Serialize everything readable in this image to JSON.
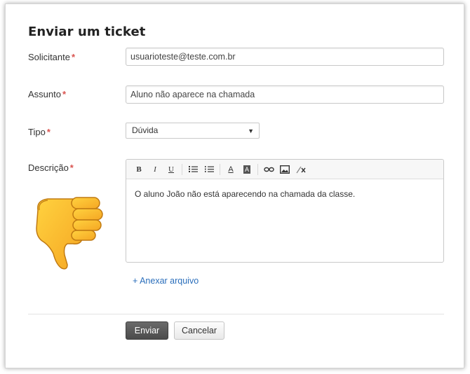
{
  "form": {
    "title": "Enviar um ticket",
    "required_mark": "*",
    "requester": {
      "label": "Solicitante",
      "value": "usuarioteste@teste.com.br"
    },
    "subject": {
      "label": "Assunto",
      "value": "Aluno não aparece na chamada"
    },
    "type": {
      "label": "Tipo",
      "value": "Dúvida",
      "caret": "▼"
    },
    "description": {
      "label": "Descrição",
      "value": "O aluno João não está aparecendo na chamada da classe.",
      "toolbar": {
        "bold": "B",
        "italic": "I",
        "underline": "U",
        "font_color": "A",
        "bg_color": "A"
      }
    },
    "attach_link": "+ Anexar arquivo",
    "submit_label": "Enviar",
    "cancel_label": "Cancelar"
  },
  "decoration": {
    "emoji": "thumbs-down-icon"
  }
}
